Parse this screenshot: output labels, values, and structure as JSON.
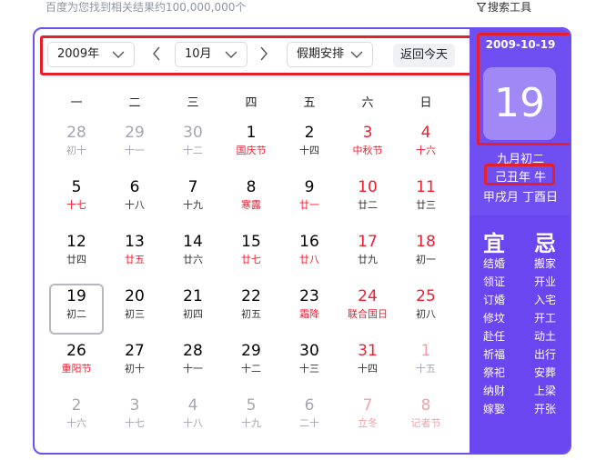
{
  "header": {
    "result_count": "百度为您找到相关结果约100,000,000个",
    "search_tools": "搜索工具"
  },
  "controls": {
    "year": "2009年",
    "month": "10月",
    "holiday": "假期安排",
    "today": "返回今天"
  },
  "weekdays": [
    "一",
    "二",
    "三",
    "四",
    "五",
    "六",
    "日"
  ],
  "weeks": [
    [
      {
        "d": "28",
        "l": "初十",
        "other": true
      },
      {
        "d": "29",
        "l": "十一",
        "other": true
      },
      {
        "d": "30",
        "l": "十二",
        "other": true
      },
      {
        "d": "1",
        "l": "国庆节",
        "lred": true
      },
      {
        "d": "2",
        "l": "十四"
      },
      {
        "d": "3",
        "l": "中秋节",
        "red": true,
        "lred": true
      },
      {
        "d": "4",
        "l": "十六",
        "red": true,
        "lred": true
      }
    ],
    [
      {
        "d": "5",
        "l": "十七",
        "lred": true
      },
      {
        "d": "6",
        "l": "十八"
      },
      {
        "d": "7",
        "l": "十九"
      },
      {
        "d": "8",
        "l": "寒露",
        "lred": true
      },
      {
        "d": "9",
        "l": "廿一",
        "lred": true
      },
      {
        "d": "10",
        "l": "廿二",
        "red": true
      },
      {
        "d": "11",
        "l": "廿三",
        "red": true
      }
    ],
    [
      {
        "d": "12",
        "l": "廿四"
      },
      {
        "d": "13",
        "l": "廿五",
        "lred": true
      },
      {
        "d": "14",
        "l": "廿六"
      },
      {
        "d": "15",
        "l": "廿七",
        "lred": true
      },
      {
        "d": "16",
        "l": "廿八",
        "lred": true
      },
      {
        "d": "17",
        "l": "廿九",
        "red": true
      },
      {
        "d": "18",
        "l": "初一",
        "red": true
      }
    ],
    [
      {
        "d": "19",
        "l": "初二",
        "selected": true
      },
      {
        "d": "20",
        "l": "初三"
      },
      {
        "d": "21",
        "l": "初四"
      },
      {
        "d": "22",
        "l": "初五"
      },
      {
        "d": "23",
        "l": "霜降",
        "lred": true
      },
      {
        "d": "24",
        "l": "联合国日",
        "red": true,
        "lred": true
      },
      {
        "d": "25",
        "l": "初八",
        "red": true
      }
    ],
    [
      {
        "d": "26",
        "l": "重阳节",
        "lred": true
      },
      {
        "d": "27",
        "l": "初十"
      },
      {
        "d": "28",
        "l": "十一"
      },
      {
        "d": "29",
        "l": "十二"
      },
      {
        "d": "30",
        "l": "十三"
      },
      {
        "d": "31",
        "l": "十四",
        "red": true
      },
      {
        "d": "1",
        "l": "十五",
        "other": true,
        "red": true
      }
    ],
    [
      {
        "d": "2",
        "l": "十六",
        "other": true
      },
      {
        "d": "3",
        "l": "十七",
        "other": true
      },
      {
        "d": "4",
        "l": "十八",
        "other": true
      },
      {
        "d": "5",
        "l": "十九",
        "other": true
      },
      {
        "d": "6",
        "l": "二十",
        "other": true
      },
      {
        "d": "7",
        "l": "立冬",
        "other": true,
        "red": true,
        "lred": true
      },
      {
        "d": "8",
        "l": "记者节",
        "other": true,
        "red": true,
        "lred": true
      }
    ]
  ],
  "side": {
    "date": "2009-10-19",
    "day": "19",
    "lunar_date": "九月初二",
    "lunar_year": "己丑年 牛",
    "ganzhi": "甲戌月 丁酉日",
    "yi_title": "宜",
    "ji_title": "忌",
    "yi": [
      "结婚",
      "领证",
      "订婚",
      "修坟",
      "赴任",
      "祈福",
      "祭祀",
      "纳财",
      "嫁娶"
    ],
    "ji": [
      "搬家",
      "开业",
      "入宅",
      "开工",
      "动土",
      "出行",
      "安葬",
      "上梁",
      "开张"
    ]
  },
  "colors": {
    "accent": "#6f4ff2",
    "highlight_box": "#e5202b",
    "holiday_red": "#f01c30"
  }
}
